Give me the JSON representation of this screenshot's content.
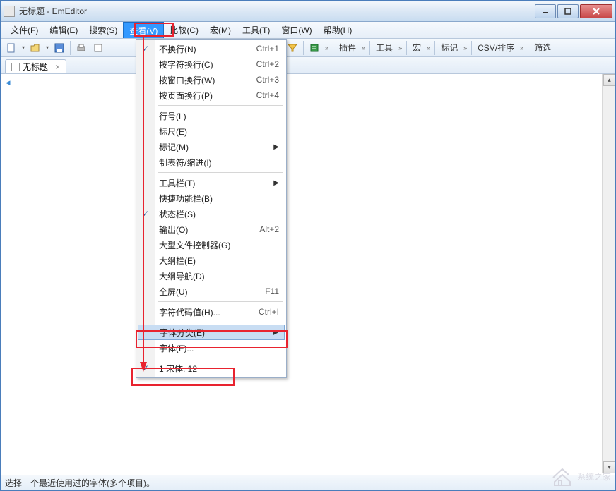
{
  "title": "无标题 - EmEditor",
  "menubar": {
    "items": [
      {
        "label": "文件(F)"
      },
      {
        "label": "编辑(E)"
      },
      {
        "label": "搜索(S)"
      },
      {
        "label": "查看(V)",
        "open": true
      },
      {
        "label": "比较(C)"
      },
      {
        "label": "宏(M)"
      },
      {
        "label": "工具(T)"
      },
      {
        "label": "窗口(W)"
      },
      {
        "label": "帮助(H)"
      }
    ]
  },
  "toolbar": {
    "groups": [
      {
        "label": "插件"
      },
      {
        "label": "工具"
      },
      {
        "label": "宏"
      },
      {
        "label": "标记"
      },
      {
        "label": "CSV/排序"
      },
      {
        "label": "筛选"
      }
    ]
  },
  "tabs": [
    {
      "label": "无标题"
    }
  ],
  "dropdown": {
    "items": [
      {
        "checked": true,
        "label": "不换行(N)",
        "shortcut": "Ctrl+1"
      },
      {
        "label": "按字符换行(C)",
        "shortcut": "Ctrl+2"
      },
      {
        "label": "按窗口换行(W)",
        "shortcut": "Ctrl+3"
      },
      {
        "label": "按页面换行(P)",
        "shortcut": "Ctrl+4"
      },
      {
        "sep": true
      },
      {
        "label": "行号(L)"
      },
      {
        "label": "标尺(E)"
      },
      {
        "label": "标记(M)",
        "submenu": true
      },
      {
        "label": "制表符/缩进(I)"
      },
      {
        "sep": true
      },
      {
        "label": "工具栏(T)",
        "submenu": true
      },
      {
        "label": "快捷功能栏(B)"
      },
      {
        "checked": true,
        "label": "状态栏(S)"
      },
      {
        "label": "输出(O)",
        "shortcut": "Alt+2"
      },
      {
        "label": "大型文件控制器(G)"
      },
      {
        "label": "大纲栏(E)"
      },
      {
        "label": "大纲导航(D)"
      },
      {
        "label": "全屏(U)",
        "shortcut": "F11"
      },
      {
        "sep": true
      },
      {
        "label": "字符代码值(H)...",
        "shortcut": "Ctrl+I"
      },
      {
        "sep": true
      },
      {
        "label": "字体分类(E)",
        "submenu": true,
        "highlight": true
      },
      {
        "label": "字体(F)..."
      },
      {
        "sep": true
      },
      {
        "checked": true,
        "label": "1 宋体, 12"
      }
    ]
  },
  "statusbar": {
    "text": "选择一个最近使用过的字体(多个项目)。"
  },
  "watermark": {
    "text": "系统之家"
  }
}
